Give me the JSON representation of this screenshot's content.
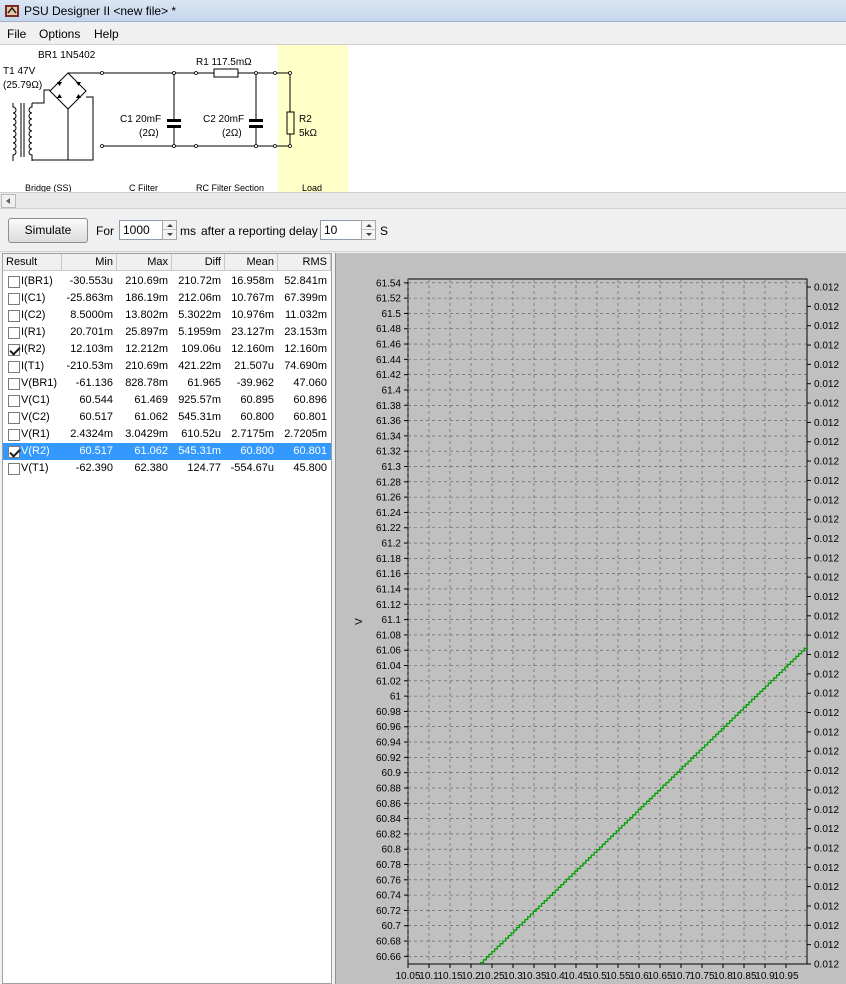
{
  "window": {
    "title": "PSU Designer II  <new file> *"
  },
  "menu": [
    "File",
    "Options",
    "Help"
  ],
  "schematic": {
    "rectifier_label": "BR1 1N5402",
    "transformer_label": "T1 47V",
    "transformer_res": "(25.79Ω)",
    "c1_label": "C1 20mF",
    "c1_res": "(2Ω)",
    "r1_label": "R1 117.5mΩ",
    "c2_label": "C2 20mF",
    "c2_res": "(2Ω)",
    "r2_label": "R2",
    "r2_value": "5kΩ",
    "sections": [
      "Bridge (SS)",
      "C Filter",
      "RC Filter Section",
      "Load"
    ]
  },
  "sim": {
    "button": "Simulate",
    "for_label": "For",
    "duration": "1000",
    "ms_label": "ms",
    "delay_label": "after a reporting delay of",
    "delay": "10",
    "s_label": "S"
  },
  "results": {
    "headers": [
      "Result",
      "Min",
      "Max",
      "Diff",
      "Mean",
      "RMS"
    ],
    "rows": [
      {
        "name": "I(BR1)",
        "checked": false,
        "selected": false,
        "min": "-30.553u",
        "max": "210.69m",
        "diff": "210.72m",
        "mean": "16.958m",
        "rms": "52.841m"
      },
      {
        "name": "I(C1)",
        "checked": false,
        "selected": false,
        "min": "-25.863m",
        "max": "186.19m",
        "diff": "212.06m",
        "mean": "10.767m",
        "rms": "67.399m"
      },
      {
        "name": "I(C2)",
        "checked": false,
        "selected": false,
        "min": "8.5000m",
        "max": "13.802m",
        "diff": "5.3022m",
        "mean": "10.976m",
        "rms": "11.032m"
      },
      {
        "name": "I(R1)",
        "checked": false,
        "selected": false,
        "min": "20.701m",
        "max": "25.897m",
        "diff": "5.1959m",
        "mean": "23.127m",
        "rms": "23.153m"
      },
      {
        "name": "I(R2)",
        "checked": true,
        "selected": false,
        "min": "12.103m",
        "max": "12.212m",
        "diff": "109.06u",
        "mean": "12.160m",
        "rms": "12.160m"
      },
      {
        "name": "I(T1)",
        "checked": false,
        "selected": false,
        "min": "-210.53m",
        "max": "210.69m",
        "diff": "421.22m",
        "mean": "21.507u",
        "rms": "74.690m"
      },
      {
        "name": "V(BR1)",
        "checked": false,
        "selected": false,
        "min": "-61.136",
        "max": "828.78m",
        "diff": "61.965",
        "mean": "-39.962",
        "rms": "47.060"
      },
      {
        "name": "V(C1)",
        "checked": false,
        "selected": false,
        "min": "60.544",
        "max": "61.469",
        "diff": "925.57m",
        "mean": "60.895",
        "rms": "60.896"
      },
      {
        "name": "V(C2)",
        "checked": false,
        "selected": false,
        "min": "60.517",
        "max": "61.062",
        "diff": "545.31m",
        "mean": "60.800",
        "rms": "60.801"
      },
      {
        "name": "V(R1)",
        "checked": false,
        "selected": false,
        "min": "2.4324m",
        "max": "3.0429m",
        "diff": "610.52u",
        "mean": "2.7175m",
        "rms": "2.7205m"
      },
      {
        "name": "V(R2)",
        "checked": true,
        "selected": true,
        "min": "60.517",
        "max": "61.062",
        "diff": "545.31m",
        "mean": "60.800",
        "rms": "60.801"
      },
      {
        "name": "V(T1)",
        "checked": false,
        "selected": false,
        "min": "-62.390",
        "max": "62.380",
        "diff": "124.77",
        "mean": "-554.67u",
        "rms": "45.800"
      }
    ]
  },
  "chart_data": {
    "type": "line",
    "ylabel": "V",
    "ylim": [
      60.65,
      61.545
    ],
    "y_ticks": [
      "61.54",
      "61.52",
      "61.5",
      "61.48",
      "61.46",
      "61.44",
      "61.42",
      "61.4",
      "61.38",
      "61.36",
      "61.34",
      "61.32",
      "61.3",
      "61.28",
      "61.26",
      "61.24",
      "61.22",
      "61.2",
      "61.18",
      "61.16",
      "61.14",
      "61.12",
      "61.1",
      "61.08",
      "61.06",
      "61.04",
      "61.02",
      "61",
      "60.98",
      "60.96",
      "60.94",
      "60.92",
      "60.9",
      "60.88",
      "60.86",
      "60.84",
      "60.82",
      "60.8",
      "60.78",
      "60.76",
      "60.74",
      "60.72",
      "60.7",
      "60.68",
      "60.66"
    ],
    "xlim": [
      10.05,
      11.0
    ],
    "x_ticks": [
      "10.05",
      "10.1",
      "10.15",
      "10.2",
      "10.25",
      "10.3",
      "10.35",
      "10.4",
      "10.45",
      "10.5",
      "10.55",
      "10.6",
      "10.65",
      "10.7",
      "10.75",
      "10.8",
      "10.85",
      "10.9",
      "10.95"
    ],
    "right_axis_ticks": [
      "0.012",
      "0.012",
      "0.012",
      "0.012",
      "0.012",
      "0.012",
      "0.012",
      "0.012",
      "0.012",
      "0.012",
      "0.012",
      "0.012",
      "0.012",
      "0.012",
      "0.012",
      "0.012",
      "0.012",
      "0.012",
      "0.012",
      "0.012",
      "0.012",
      "0.012",
      "0.012",
      "0.012",
      "0.012",
      "0.012",
      "0.012",
      "0.012",
      "0.012",
      "0.012",
      "0.012",
      "0.012",
      "0.012",
      "0.012",
      "0.012",
      "0.012"
    ],
    "grid": true,
    "series": [
      {
        "color": "#00a000",
        "x": [
          10.21,
          11.0
        ],
        "y": [
          60.645,
          61.066
        ]
      }
    ]
  },
  "colors": {
    "selection": "#3399ff",
    "plot_bg": "#c0c0c0",
    "series": "#00a000",
    "load_highlight": "#ffffc8"
  }
}
